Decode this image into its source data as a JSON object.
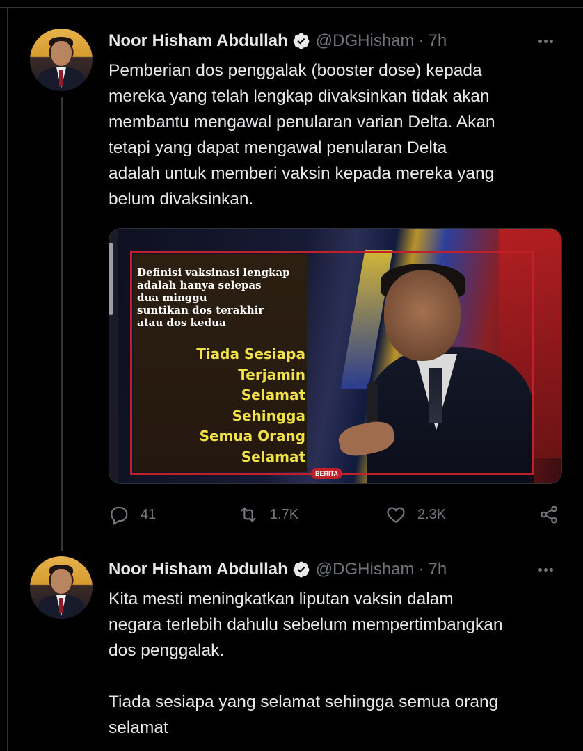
{
  "colors": {
    "background": "#000000",
    "text_primary": "#e7e9ea",
    "text_secondary": "#71767b",
    "verified_badge": "#e7e9ea",
    "thread_line": "#333639",
    "slogan_yellow": "#f2e24a",
    "frame_red": "#c0202a"
  },
  "tweets": [
    {
      "author_name": "Noor Hisham Abdullah",
      "handle": "@DGHisham",
      "separator": "·",
      "time": "7h",
      "verified_icon": "verified-badge-icon",
      "more_icon": "more-dots-icon",
      "text_lines": [
        "Pemberian dos penggalak (booster dose) kepada",
        "mereka yang telah lengkap divaksinkan tidak akan",
        "membantu mengawal penularan varian Delta. Akan",
        "tetapi yang dapat  mengawal penularan Delta",
        "adalah untuk memberi vaksin kepada mereka yang",
        "belum divaksinkan."
      ],
      "media": {
        "definition_lines": [
          "Definisi vaksinasi lengkap",
          "adalah hanya selepas",
          "dua minggu",
          "suntikan dos terakhir",
          "atau dos kedua"
        ],
        "slogan_lines": [
          "Tiada Sesiapa",
          "Terjamin",
          "Selamat",
          "Sehingga",
          "Semua Orang",
          "Selamat"
        ],
        "badge": "BERITA"
      },
      "actions": {
        "reply_count": "41",
        "retweet_count": "1.7K",
        "like_count": "2.3K",
        "reply_icon": "reply-icon",
        "retweet_icon": "retweet-icon",
        "like_icon": "heart-icon",
        "share_icon": "share-icon"
      }
    },
    {
      "author_name": "Noor Hisham Abdullah",
      "handle": "@DGHisham",
      "separator": "·",
      "time": "7h",
      "verified_icon": "verified-badge-icon",
      "more_icon": "more-dots-icon",
      "text_lines": [
        "Kita mesti meningkatkan liputan vaksin dalam",
        "negara terlebih dahulu sebelum mempertimbangkan",
        "dos penggalak."
      ],
      "text_lines_2": [
        "Tiada sesiapa yang selamat sehingga semua orang",
        "selamat"
      ]
    }
  ]
}
